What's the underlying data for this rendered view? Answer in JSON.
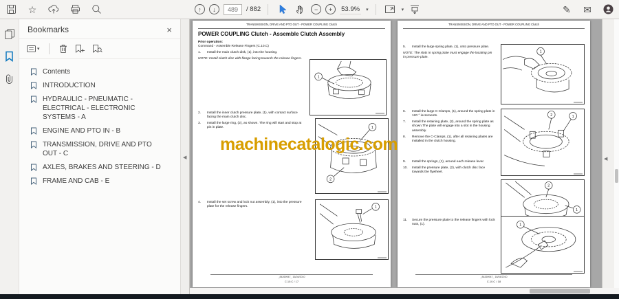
{
  "glyphs": {
    "close": "×",
    "caret": "▾",
    "collapse_left": "◀",
    "up": "↑",
    "down": "↓",
    "minus": "−",
    "plus": "+",
    "star": "☆",
    "envelope": "✉",
    "pen": "✎"
  },
  "toolbar": {
    "page_current": "489",
    "page_total": "/ 882",
    "zoom_level": "53.9%"
  },
  "bookmarks": {
    "title": "Bookmarks",
    "items": [
      "Contents",
      "INTRODUCTION",
      "HYDRAULIC - PNEUMATIC - ELECTRICAL - ELECTRONIC SYSTEMS - A",
      "ENGINE AND PTO IN - B",
      "TRANSMISSION, DRIVE AND PTO OUT - C",
      "AXLES, BRAKES AND STEERING - D",
      "FRAME AND CAB - E"
    ]
  },
  "watermark": {
    "text": "machinecatalogic.com",
    "color": "#D89E00"
  },
  "document": {
    "page_header": "TRANSMISSION, DRIVE AND PTO OUT - POWER COUPLING Clutch",
    "title": "POWER COUPLING Clutch - Assemble Clutch Assembly",
    "prior_label": "Prior operation:",
    "prior_command": "Command - Assemble Release Fingers (C.10.C)",
    "left_note": "NOTE: Install clutch disc with flange facing towards the release fingers.",
    "right_note": "NOTE: The slots in spring plate must engage the locating pin in pressure plate.",
    "left_steps": [
      {
        "num": "1.",
        "text": "Install the main clutch disk, (1), into the housing."
      },
      {
        "num": "2.",
        "text": "Install the inner clutch pressure plate, (1), with contact surface facing the main clutch disc."
      },
      {
        "num": "3.",
        "text": "Install the large ring, (2), as shown. The ring will start and stop at pin in plate."
      },
      {
        "num": "4.",
        "text": "Install the set screw and lock nut assembly, (1), into the pressure plate for the release fingers."
      }
    ],
    "right_steps": [
      {
        "num": "5.",
        "text": "Install the large spring plate, (1), onto pressure plate."
      },
      {
        "num": "6.",
        "text": "Install the large C-Clamps, (1), around the spring plate in 120 ° increments."
      },
      {
        "num": "7.",
        "text": "Install the retaining plate, (2), around the spring plate as shown.The plate will engage into a slot in the housing assembly."
      },
      {
        "num": "8.",
        "text": "Remove the C-Clamps, (1), after all retaining plates are installed in the clutch housing."
      },
      {
        "num": "9.",
        "text": "Install the springs, (1), around each release lever."
      },
      {
        "num": "10.",
        "text": "Install the pressure plate, (2), with clutch disc face towards the flywheel."
      },
      {
        "num": "11.",
        "text": "Secure the pressure plate to the release fingers with lock nuts, (1)."
      }
    ],
    "left_figures": [
      {
        "callouts": [
          "1"
        ]
      },
      {
        "callouts": [
          "1",
          "2"
        ]
      },
      {
        "callouts": [
          "1"
        ]
      }
    ],
    "right_figures": [
      {
        "callouts": [
          "1"
        ]
      },
      {
        "callouts": [
          "2",
          "1"
        ]
      },
      {
        "callouts": [
          "2",
          "1"
        ]
      },
      {
        "callouts": [
          "1"
        ]
      }
    ],
    "footer_code": "_84269947_ 16/04/2010",
    "left_footer_page": "C.10.C / 17",
    "right_footer_page": "C.10.C / 18"
  }
}
